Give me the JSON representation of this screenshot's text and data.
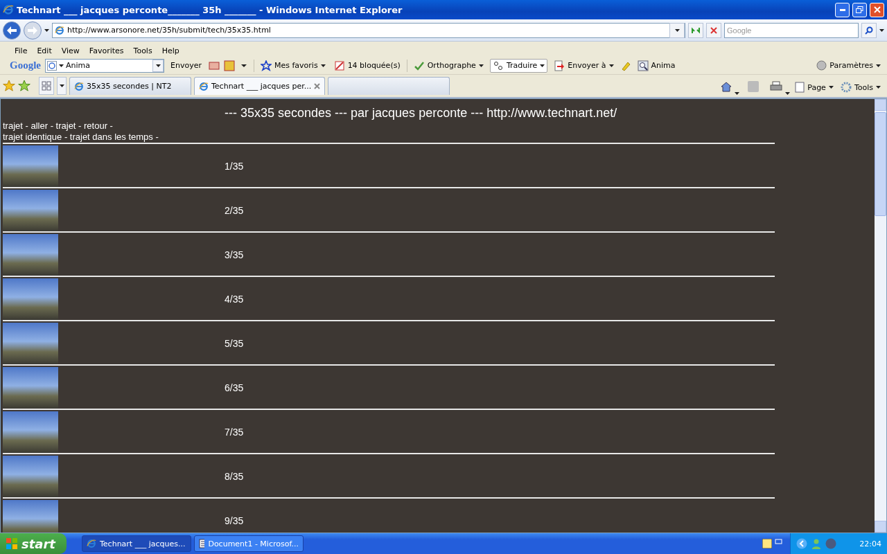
{
  "window": {
    "title": "Technart ___ jacques perconte_______ 35h _______ - Windows Internet Explorer"
  },
  "address": {
    "url": "http://www.arsonore.net/35h/submit/tech/35x35.html"
  },
  "search": {
    "placeholder": "Google"
  },
  "menu": [
    "File",
    "Edit",
    "View",
    "Favorites",
    "Tools",
    "Help"
  ],
  "google_toolbar": {
    "logo": "Google",
    "search_value": "Anima",
    "send": "Envoyer",
    "items": [
      {
        "kind": "favorites",
        "label": "Mes favoris"
      },
      {
        "kind": "blocked",
        "label": "14 bloquée(s)"
      },
      {
        "kind": "spell",
        "label": "Orthographe"
      },
      {
        "kind": "translate",
        "label": "Traduire"
      },
      {
        "kind": "sendto",
        "label": "Envoyer à"
      },
      {
        "kind": "lookup",
        "label": "Anima"
      }
    ],
    "settings": "Paramètres"
  },
  "tabs": [
    {
      "label": "35x35 secondes | NT2",
      "selected": false
    },
    {
      "label": "Technart ___ jacques per...",
      "selected": true
    }
  ],
  "command_bar": [
    "Page",
    "Tools"
  ],
  "page": {
    "heading": "--- 35x35 secondes --- par jacques perconte --- http://www.technart.net/",
    "intro_lines": [
      "trajet - aller - trajet - retour -",
      "trajet identique - trajet dans les temps -"
    ],
    "entries": [
      {
        "label": "1/35"
      },
      {
        "label": "2/35"
      },
      {
        "label": "3/35"
      },
      {
        "label": "4/35"
      },
      {
        "label": "5/35"
      },
      {
        "label": "6/35"
      },
      {
        "label": "7/35"
      },
      {
        "label": "8/35"
      },
      {
        "label": "9/35"
      }
    ]
  },
  "taskbar": {
    "start": "start",
    "tasks": [
      {
        "label": "Technart ___ jacques...",
        "kind": "browser",
        "selected": true
      },
      {
        "label": "Document1 - Microsof...",
        "kind": "document",
        "selected": false
      }
    ],
    "clock": "22:04"
  }
}
